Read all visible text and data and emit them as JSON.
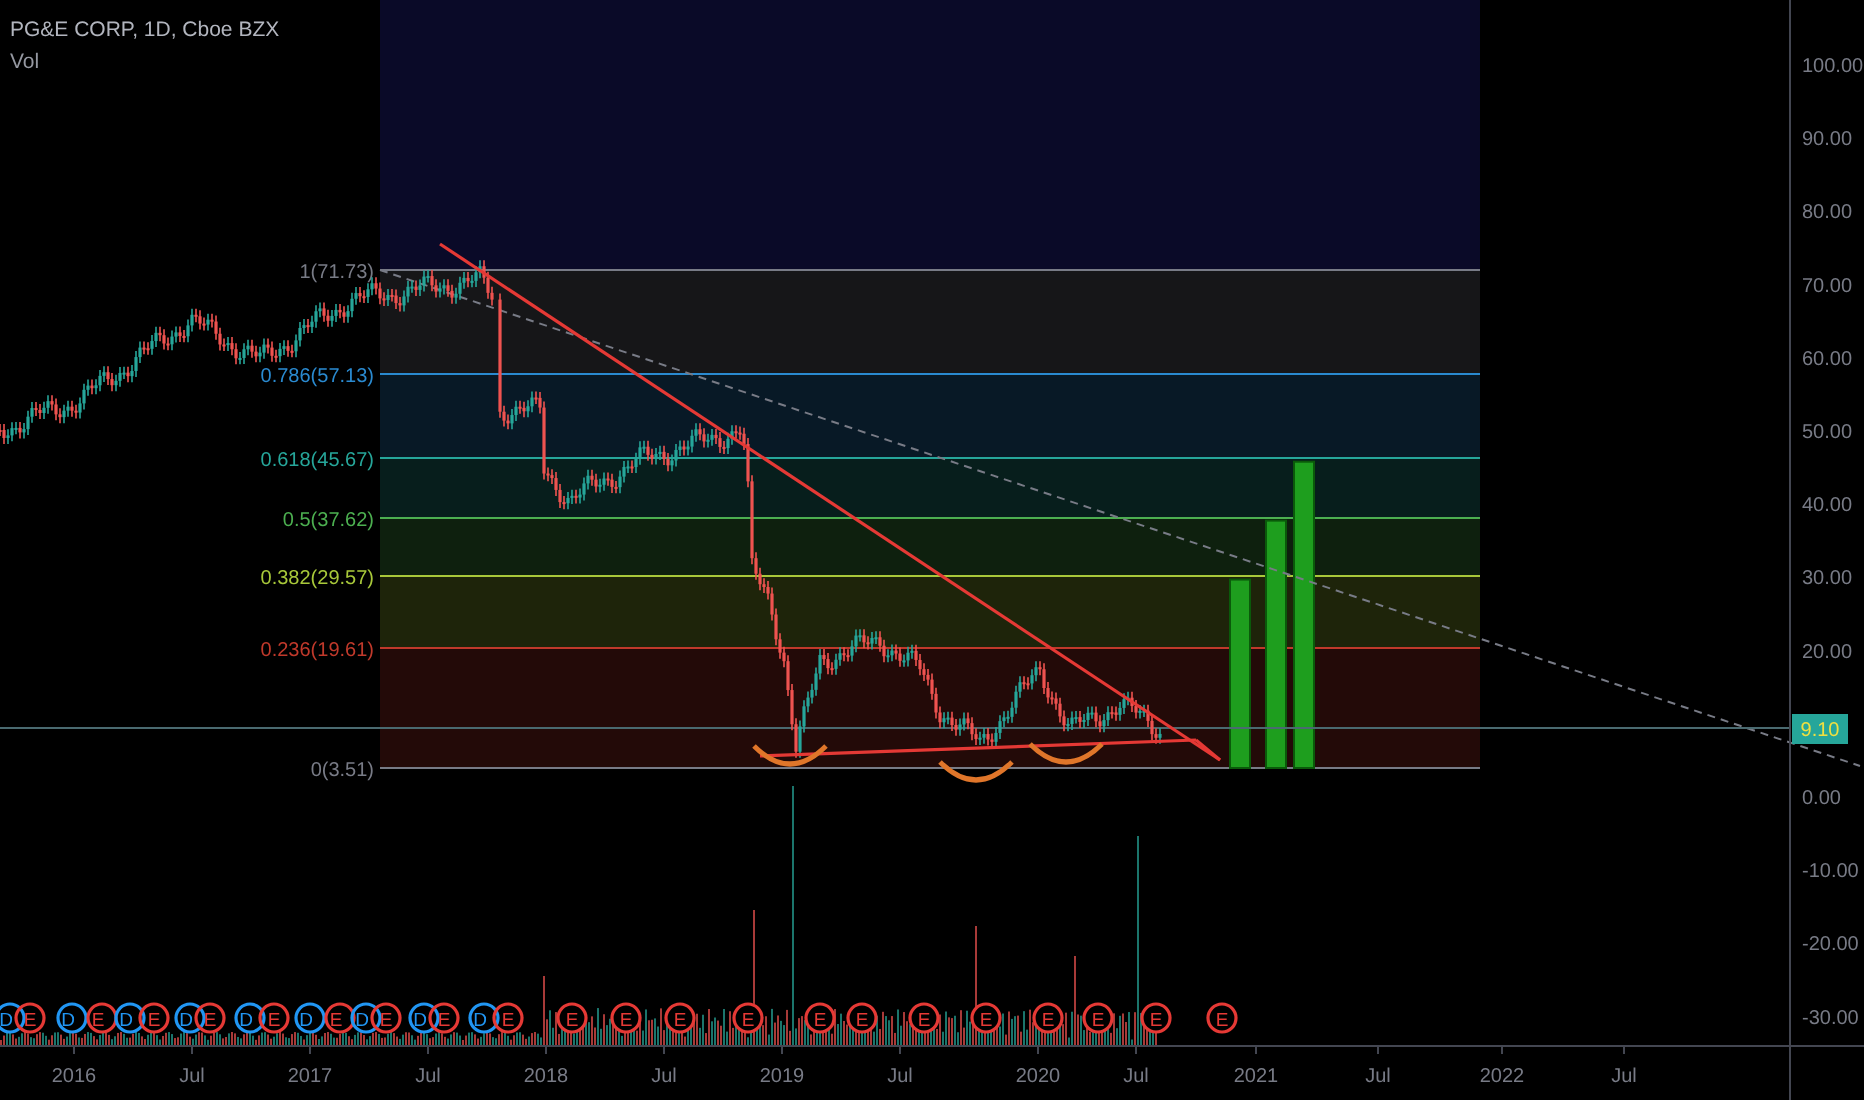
{
  "header": {
    "symbol": "PG&E CORP, 1D, Cboe BZX",
    "indicator": "Vol"
  },
  "price_axis": [
    "100.00",
    "90.00",
    "80.00",
    "70.00",
    "60.00",
    "50.00",
    "40.00",
    "30.00",
    "20.00",
    "0.00",
    "-10.00",
    "-20.00",
    "-30.00"
  ],
  "current_price": {
    "label": "9.10"
  },
  "fib_levels": [
    {
      "label": "1(71.73)",
      "color": "#787b86"
    },
    {
      "label": "0.786(57.13)",
      "color": "#2a8ad0"
    },
    {
      "label": "0.618(45.67)",
      "color": "#26a69a"
    },
    {
      "label": "0.5(37.62)",
      "color": "#4caf50"
    },
    {
      "label": "0.382(29.57)",
      "color": "#a8c83a"
    },
    {
      "label": "0.236(19.61)",
      "color": "#c0392b"
    },
    {
      "label": "0(3.51)",
      "color": "#787b86"
    }
  ],
  "time_axis": [
    "2016",
    "Jul",
    "2017",
    "Jul",
    "2018",
    "Jul",
    "2019",
    "Jul",
    "2020",
    "Jul",
    "2021",
    "Jul",
    "2022",
    "Jul"
  ],
  "events": [
    {
      "letter": "D",
      "color": "#2196f3"
    },
    {
      "letter": "E",
      "color": "#e53935"
    },
    {
      "letter": "D",
      "color": "#2196f3"
    },
    {
      "letter": "E",
      "color": "#e53935"
    },
    {
      "letter": "D",
      "color": "#2196f3"
    },
    {
      "letter": "E",
      "color": "#e53935"
    },
    {
      "letter": "D",
      "color": "#2196f3"
    },
    {
      "letter": "E",
      "color": "#e53935"
    },
    {
      "letter": "D",
      "color": "#2196f3"
    },
    {
      "letter": "E",
      "color": "#e53935"
    },
    {
      "letter": "D",
      "color": "#2196f3"
    },
    {
      "letter": "E",
      "color": "#e53935"
    },
    {
      "letter": "D",
      "color": "#2196f3"
    },
    {
      "letter": "E",
      "color": "#e53935"
    },
    {
      "letter": "D",
      "color": "#2196f3"
    },
    {
      "letter": "E",
      "color": "#e53935"
    },
    {
      "letter": "D",
      "color": "#2196f3"
    },
    {
      "letter": "E",
      "color": "#e53935"
    },
    {
      "letter": "E",
      "color": "#e53935"
    },
    {
      "letter": "E",
      "color": "#e53935"
    },
    {
      "letter": "E",
      "color": "#e53935"
    },
    {
      "letter": "E",
      "color": "#e53935"
    },
    {
      "letter": "E",
      "color": "#e53935"
    },
    {
      "letter": "E",
      "color": "#e53935"
    },
    {
      "letter": "E",
      "color": "#e53935"
    },
    {
      "letter": "E",
      "color": "#e53935"
    },
    {
      "letter": "E",
      "color": "#e53935"
    },
    {
      "letter": "E",
      "color": "#e53935"
    },
    {
      "letter": "E",
      "color": "#e53935"
    },
    {
      "letter": "E",
      "color": "#e53935"
    }
  ]
}
